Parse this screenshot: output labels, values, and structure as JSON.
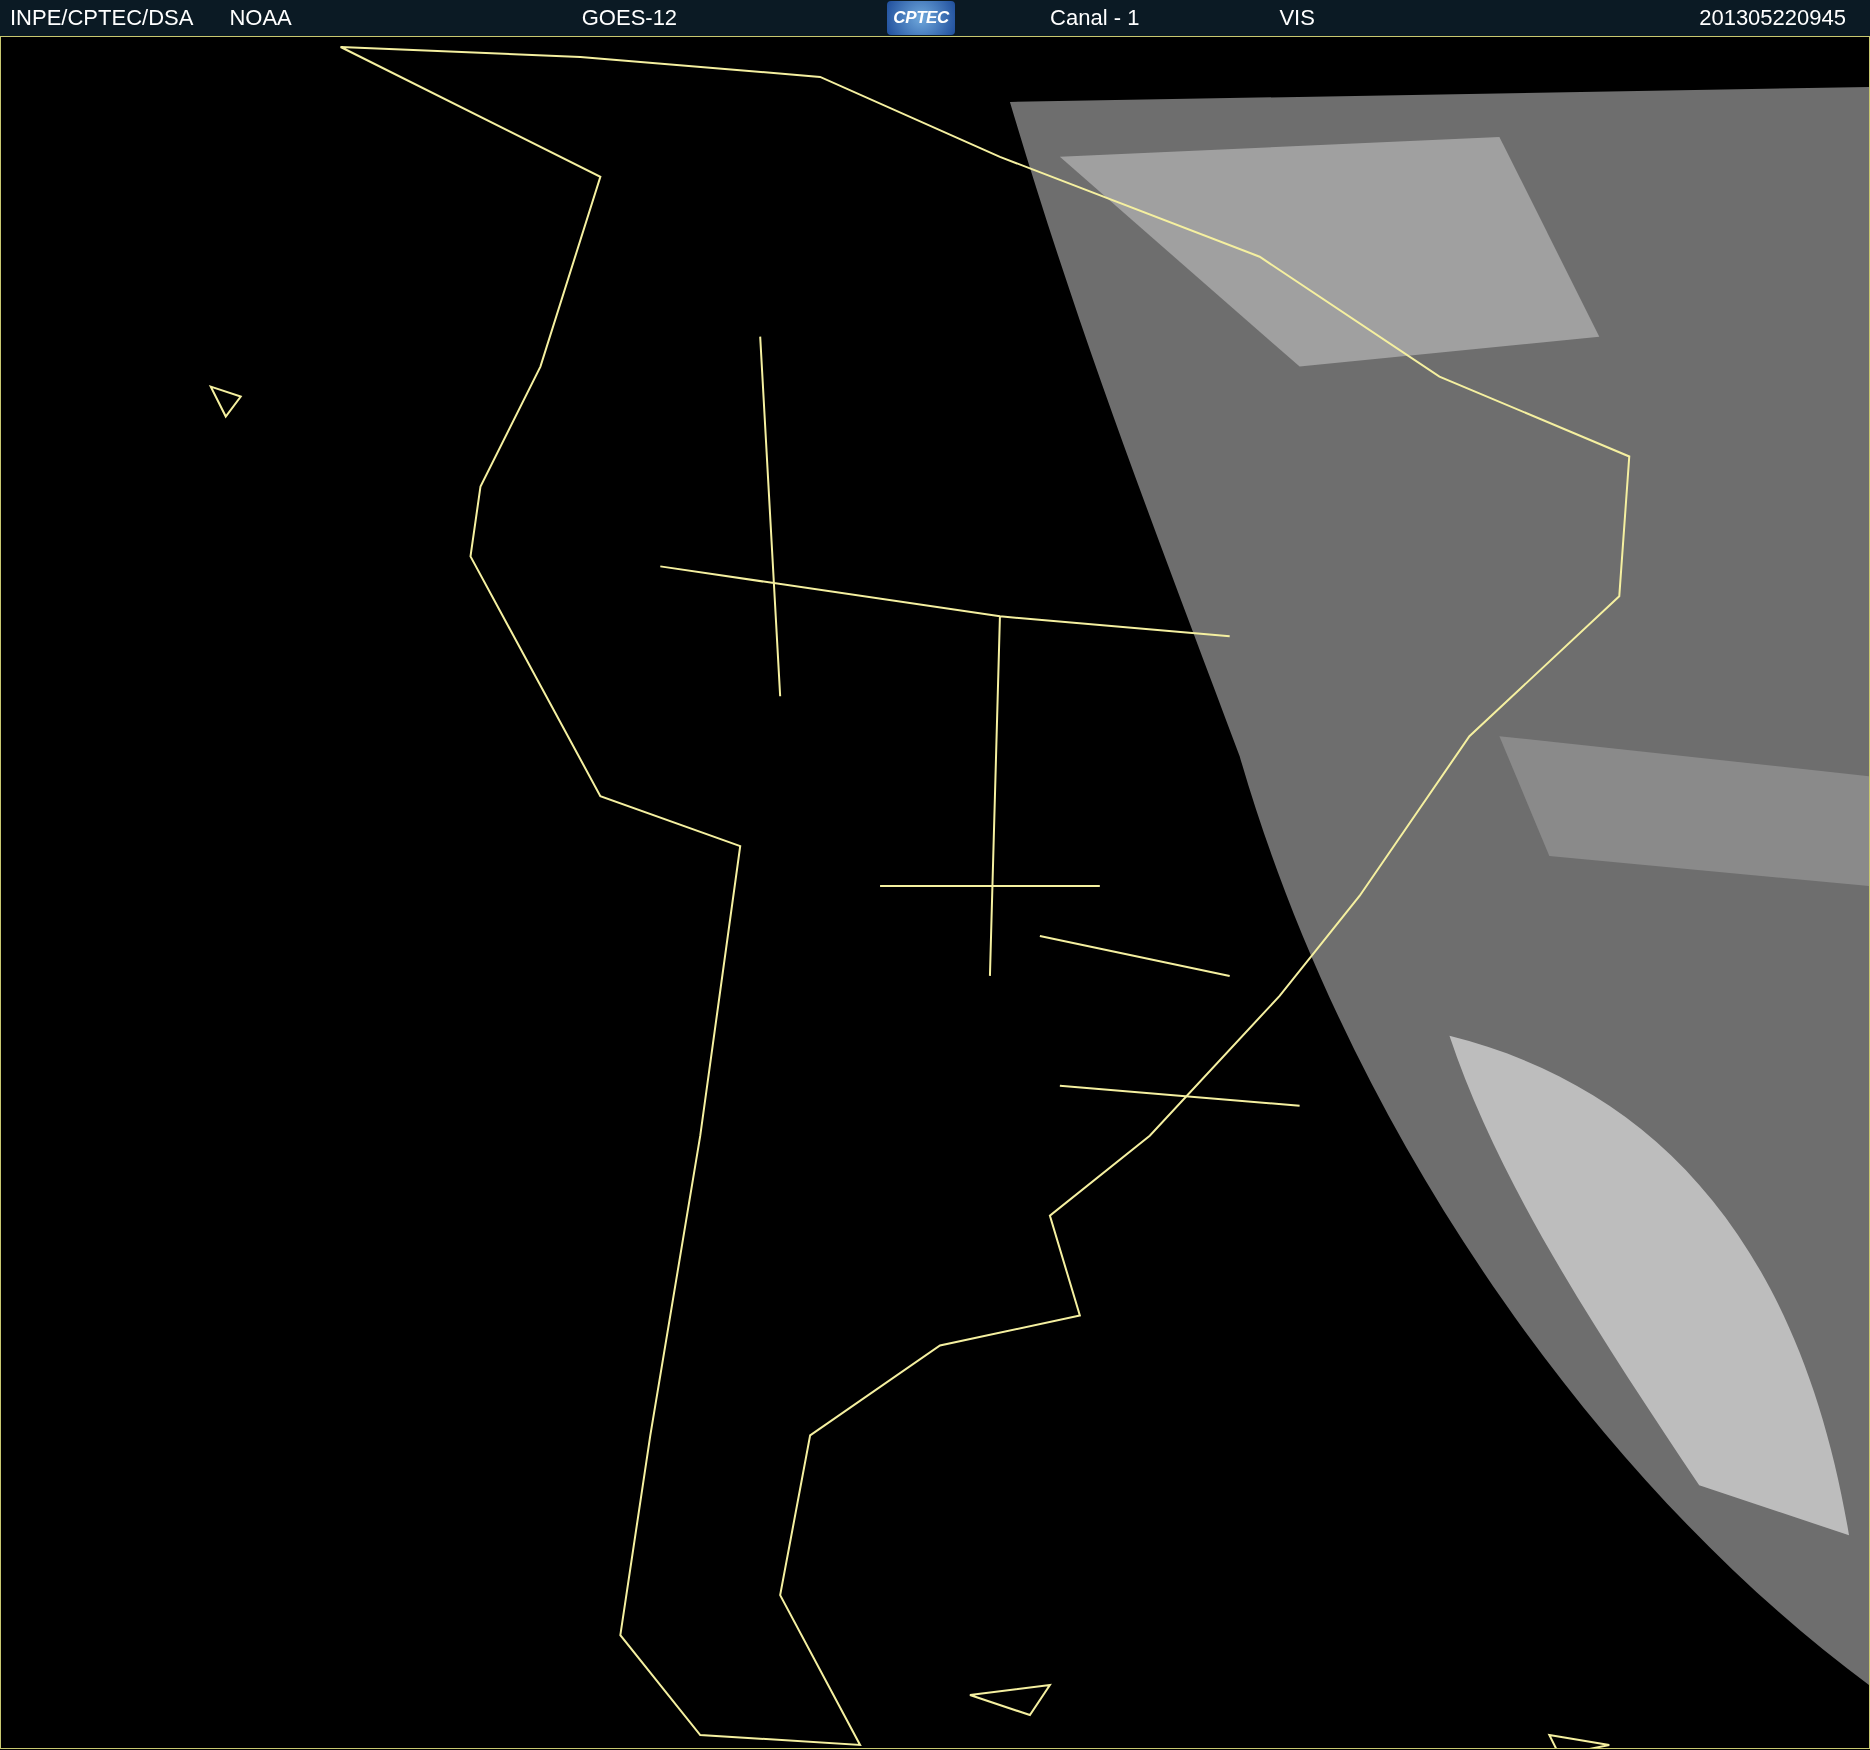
{
  "header": {
    "agency": "INPE/CPTEC/DSA",
    "source": "NOAA",
    "satellite": "GOES-12",
    "logo": "CPTEC",
    "channel": "Canal - 1",
    "band": "VIS",
    "timestamp": "201305220945"
  }
}
